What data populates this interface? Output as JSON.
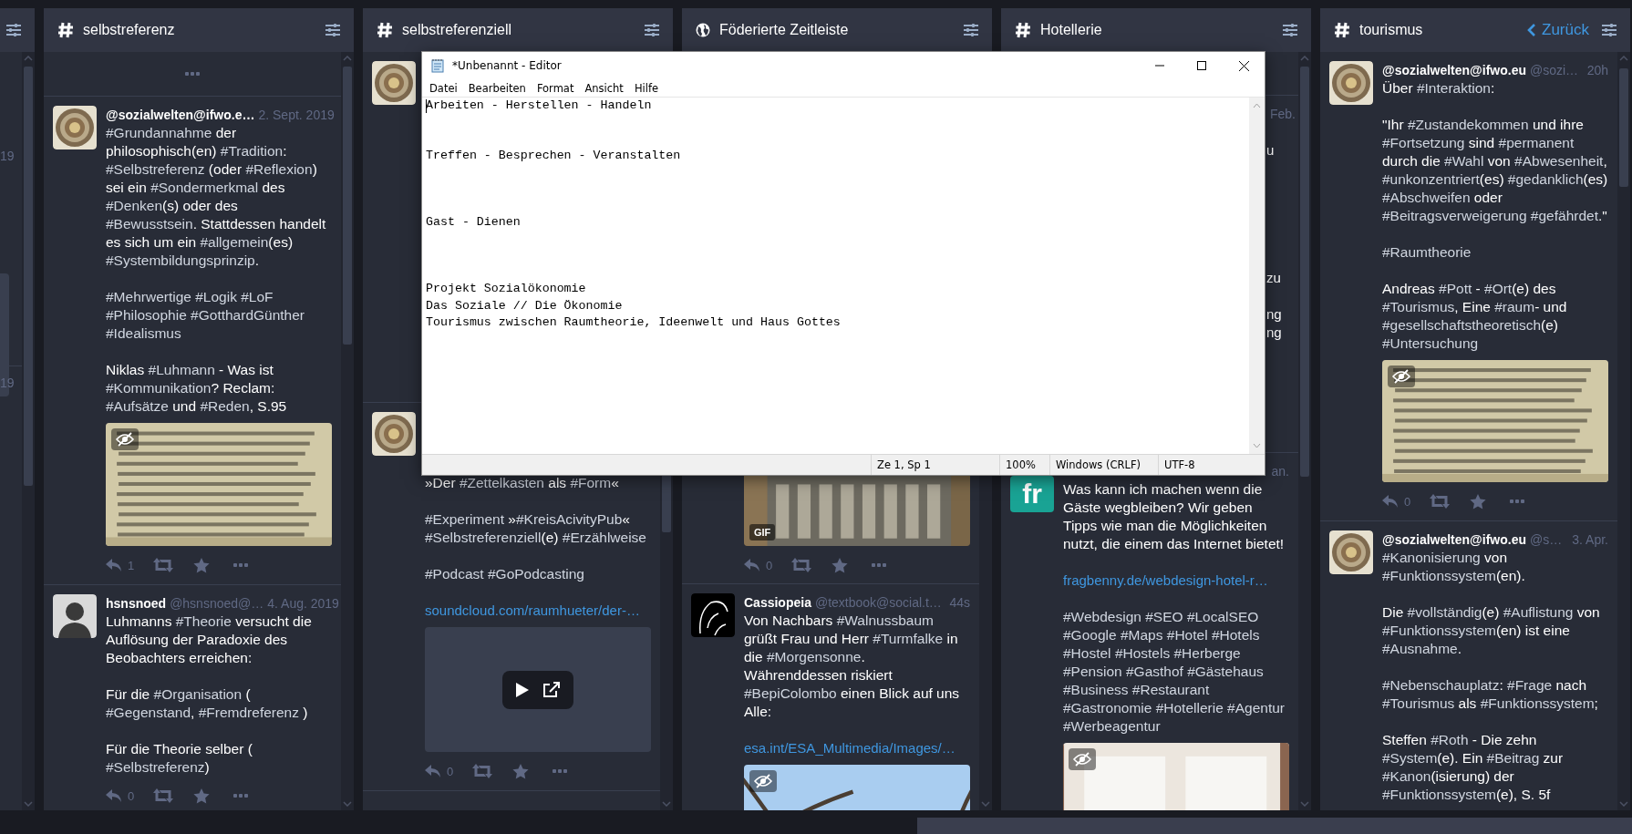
{
  "columns": [
    {
      "kind": "partial",
      "posts": [
        {
          "time": "19"
        },
        {
          "time": "19"
        }
      ]
    },
    {
      "kind": "hashtag",
      "title": "selbstreferenz",
      "load_more": true,
      "posts": [
        {
          "avatar": {
            "kind": "plate"
          },
          "display_name": "@sozialwelten@ifwo.e…",
          "time": "2. Sept. 2019",
          "paragraphs": [
            {
              "kind": "text",
              "text": "#Grundannahme der philosophisch(en) #Tradition: #Selbstreferenz (oder #Reflexion) sei ein #Sondermerkmal des #Denken(s) oder des #Bewusstsein. Stattdessen handelt es sich um ein #allgemein(es) #Systembildungsprinzip.\n\n#Mehrwertige #Logik #LoF #Philosophie #GotthardGünther #Idealismus\n\nNiklas #Luhmann - Was ist #Kommunikation? Reclam: #Aufsätze und #Reden, S.95"
            }
          ],
          "media": {
            "kind": "picture"
          },
          "replies": "1"
        },
        {
          "avatar": {
            "kind": "portrait"
          },
          "display_name": "hsnsnoed",
          "acct": "@hsnsnoed@…",
          "time": "4. Aug. 2019",
          "paragraphs": [
            {
              "kind": "text",
              "text": "Luhmanns #Theorie versucht die Auflösung der Paradoxie des Beobachters erreichen:\n\nFür die #Organisation ( #Gegenstand, #Fremdreferenz )\n\nFür die Theorie selber ( #Selbstreferenz)"
            }
          ],
          "replies": "0"
        }
      ]
    },
    {
      "kind": "hashtag",
      "title": "selbstreferenziell",
      "posts": [
        {
          "avatar": {
            "kind": "plate"
          }
        },
        {
          "avatar": {
            "kind": "plate"
          },
          "paragraphs": [
            {
              "kind": "text",
              "text": "»Der #Zettelkasten als #Form«\n\n#Experiment »#KreisAcivityPub«\n#Selbstreferenziell(e) #Erzählweise\n\n#Podcast #GoPodcasting"
            },
            {
              "kind": "link",
              "text": "soundcloud.com/raumhueter/der-…"
            }
          ],
          "media": {
            "kind": "audio"
          },
          "replies": "0"
        }
      ]
    },
    {
      "kind": "federated",
      "title": "Föderierte Zeitleiste",
      "posts": [
        {
          "media": {
            "kind": "gif",
            "badge": "GIF"
          },
          "replies": "0"
        },
        {
          "avatar": {
            "kind": "sketch"
          },
          "display_name": "Cassiopeia",
          "acct": "@textbook@social.t…",
          "time": "44s",
          "paragraphs": [
            {
              "kind": "text",
              "text": "Von Nachbars #Walnussbaum grüßt Frau und Herr #Turmfalke in die #Morgensonne. Währenddessen riskiert #BepiColombo einen Blick auf uns Alle:"
            },
            {
              "kind": "link",
              "text": "esa.int/ESA_Multimedia/Images/…"
            }
          ],
          "media": {
            "kind": "picture"
          }
        }
      ]
    },
    {
      "kind": "hashtag",
      "title": "Hotellerie",
      "posts": [
        {
          "time": "Feb.",
          "fragments": [
            "u",
            "zu",
            "ng",
            "ng"
          ]
        },
        {
          "avatar": {
            "kind": "initials",
            "text": "fr"
          },
          "time": "an.",
          "paragraphs": [
            {
              "kind": "text",
              "text": "Was kann ich machen wenn die Gäste wegbleiben? Wir geben Tipps wie man die Möglichkeiten nutzt, die einem das Internet bietet!"
            },
            {
              "kind": "link",
              "text": "fragbenny.de/webdesign-hotel-r…"
            },
            {
              "kind": "text",
              "text": "#Webdesign #SEO #LocalSEO #Google #Maps #Hotel #Hotels #Hostel #Hostels #Herberge #Pension #Gasthof #Gästehaus #Business #Restaurant #Gastronomie #Hotellerie #Agentur #Werbeagentur"
            }
          ],
          "media": {
            "kind": "picture"
          }
        }
      ]
    },
    {
      "kind": "hashtag",
      "title": "tourismus",
      "back": "Zurück",
      "posts": [
        {
          "avatar": {
            "kind": "plate"
          },
          "display_name": "@sozialwelten@ifwo.eu",
          "acct": "@sozi…",
          "time": "20h",
          "paragraphs": [
            {
              "kind": "text",
              "text": "Über #Interaktion:\n\n\"Ihr #Zustandekommen und ihre #Fortsetzung sind #permanent durch die #Wahl von #Abwesenheit, #unkonzentriert(es) #gedanklich(es) #Abschweifen oder #Beitragsverweigerung #gefährdet.\"\n\n#Raumtheorie\n\nAndreas #Pott - #Ort(e) des #Tourismus, Eine #raum- und #gesellschaftstheoretisch(e) #Untersuchung"
            }
          ],
          "media": {
            "kind": "picture"
          },
          "replies": "0"
        },
        {
          "avatar": {
            "kind": "plate"
          },
          "display_name": "@sozialwelten@ifwo.eu",
          "acct": "@s…",
          "time": "3. Apr.",
          "paragraphs": [
            {
              "kind": "text",
              "text": "#Kanonisierung von #Funktionssystem(en).\n\nDie #vollständig(e) #Auflistung von #Funktionssystem(en) ist eine #Ausnahme.\n\n#Nebenschauplatz: #Frage nach #Tourismus als #Funktionssystem;\n\nSteffen #Roth - Die zehn #System(e). Ein #Beitrag zur #Kanon(isierung) der #Funktionssystem(e), S. 5f"
            }
          ]
        }
      ]
    }
  ],
  "editor": {
    "title": "*Unbenannt - Editor",
    "menu": [
      "Datei",
      "Bearbeiten",
      "Format",
      "Ansicht",
      "Hilfe"
    ],
    "text": "Arbeiten - Herstellen - Handeln\n\n\nTreffen - Besprechen - Veranstalten\n\n\n\nGast - Dienen\n\n\n\nProjekt Sozialökonomie\nDas Soziale // Die Ökonomie\nTourismus zwischen Raumtheorie, Ideenwelt und Haus Gottes",
    "status": [
      "Ze 1, Sp 1",
      "100%",
      "Windows (CRLF)",
      "UTF-8"
    ]
  }
}
